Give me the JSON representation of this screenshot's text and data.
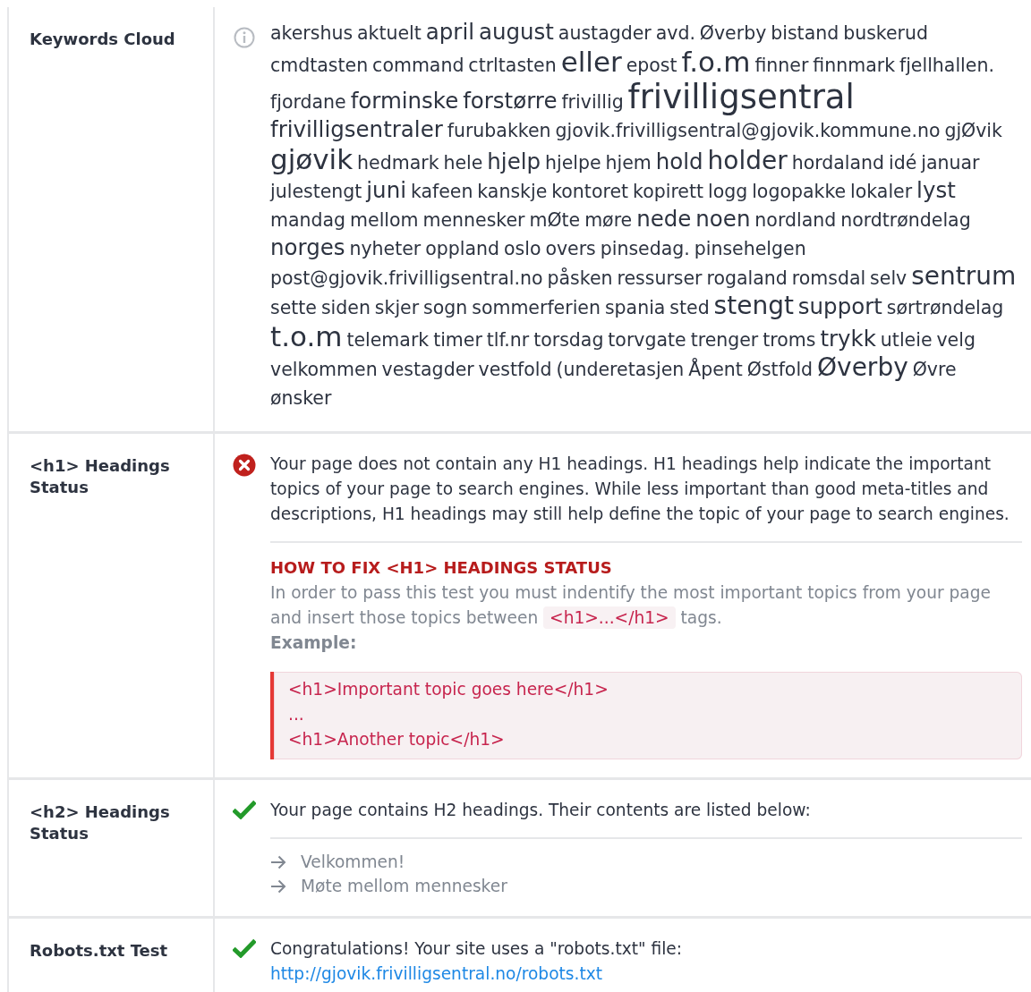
{
  "rows": [
    {
      "label": "Keywords Cloud",
      "kind": "info",
      "keywords": [
        {
          "word": "akershus",
          "kind": "low"
        },
        {
          "word": "aktuelt",
          "kind": "low"
        },
        {
          "word": "april",
          "kind": "medium"
        },
        {
          "word": "august",
          "kind": "medium"
        },
        {
          "word": "austagder",
          "kind": "low"
        },
        {
          "word": "avd.",
          "kind": "low"
        },
        {
          "word": "Øverby",
          "kind": "low"
        },
        {
          "word": "bistand",
          "kind": "low"
        },
        {
          "word": "buskerud",
          "kind": "low"
        },
        {
          "word": "cmdtasten",
          "kind": "low"
        },
        {
          "word": "command",
          "kind": "low"
        },
        {
          "word": "ctrltasten",
          "kind": "low"
        },
        {
          "word": "eller",
          "kind": "higher"
        },
        {
          "word": "epost",
          "kind": "low"
        },
        {
          "word": "f.o.m",
          "kind": "higher"
        },
        {
          "word": "finner",
          "kind": "low"
        },
        {
          "word": "finnmark",
          "kind": "low"
        },
        {
          "word": "fjellhallen.",
          "kind": "low"
        },
        {
          "word": "fjordane",
          "kind": "low"
        },
        {
          "word": "forminske",
          "kind": "medium"
        },
        {
          "word": "forstørre",
          "kind": "medium"
        },
        {
          "word": "frivillig",
          "kind": "low"
        },
        {
          "word": "frivilligsentral",
          "kind": "top"
        },
        {
          "word": "frivilligsentraler",
          "kind": "medium"
        },
        {
          "word": "furubakken",
          "kind": "low"
        },
        {
          "word": "gjovik.frivilligsentral@gjovik.kommune.no",
          "kind": "low"
        },
        {
          "word": "gjØvik",
          "kind": "low"
        },
        {
          "word": "gjøvik",
          "kind": "higher"
        },
        {
          "word": "hedmark",
          "kind": "low"
        },
        {
          "word": "hele",
          "kind": "low"
        },
        {
          "word": "hjelp",
          "kind": "medium"
        },
        {
          "word": "hjelpe",
          "kind": "low"
        },
        {
          "word": "hjem",
          "kind": "low"
        },
        {
          "word": "hold",
          "kind": "medium"
        },
        {
          "word": "holder",
          "kind": "high"
        },
        {
          "word": "hordaland",
          "kind": "low"
        },
        {
          "word": "idé",
          "kind": "low"
        },
        {
          "word": "januar",
          "kind": "low"
        },
        {
          "word": "julestengt",
          "kind": "low"
        },
        {
          "word": "juni",
          "kind": "medium"
        },
        {
          "word": "kafeen",
          "kind": "low"
        },
        {
          "word": "kanskje",
          "kind": "low"
        },
        {
          "word": "kontoret",
          "kind": "low"
        },
        {
          "word": "kopirett",
          "kind": "low"
        },
        {
          "word": "logg",
          "kind": "low"
        },
        {
          "word": "logopakke",
          "kind": "low"
        },
        {
          "word": "lokaler",
          "kind": "low"
        },
        {
          "word": "lyst",
          "kind": "medium"
        },
        {
          "word": "mandag",
          "kind": "low"
        },
        {
          "word": "mellom",
          "kind": "low"
        },
        {
          "word": "mennesker",
          "kind": "low"
        },
        {
          "word": "mØte",
          "kind": "low"
        },
        {
          "word": "møre",
          "kind": "low"
        },
        {
          "word": "nede",
          "kind": "medium"
        },
        {
          "word": "noen",
          "kind": "medium"
        },
        {
          "word": "nordland",
          "kind": "low"
        },
        {
          "word": "nordtrøndelag",
          "kind": "low"
        },
        {
          "word": "norges",
          "kind": "medium"
        },
        {
          "word": "nyheter",
          "kind": "low"
        },
        {
          "word": "oppland",
          "kind": "low"
        },
        {
          "word": "oslo",
          "kind": "low"
        },
        {
          "word": "overs",
          "kind": "low"
        },
        {
          "word": "pinsedag.",
          "kind": "low"
        },
        {
          "word": "pinsehelgen",
          "kind": "low"
        },
        {
          "word": "post@gjovik.frivilligsentral.no",
          "kind": "low"
        },
        {
          "word": "påsken",
          "kind": "low"
        },
        {
          "word": "ressurser",
          "kind": "low"
        },
        {
          "word": "rogaland",
          "kind": "low"
        },
        {
          "word": "romsdal",
          "kind": "low"
        },
        {
          "word": "selv",
          "kind": "low"
        },
        {
          "word": "sentrum",
          "kind": "high"
        },
        {
          "word": "sette",
          "kind": "low"
        },
        {
          "word": "siden",
          "kind": "low"
        },
        {
          "word": "skjer",
          "kind": "low"
        },
        {
          "word": "sogn",
          "kind": "low"
        },
        {
          "word": "sommerferien",
          "kind": "low"
        },
        {
          "word": "spania",
          "kind": "low"
        },
        {
          "word": "sted",
          "kind": "low"
        },
        {
          "word": "stengt",
          "kind": "high"
        },
        {
          "word": "support",
          "kind": "medium"
        },
        {
          "word": "sørtrøndelag",
          "kind": "low"
        },
        {
          "word": "t.o.m",
          "kind": "higher"
        },
        {
          "word": "telemark",
          "kind": "low"
        },
        {
          "word": "timer",
          "kind": "low"
        },
        {
          "word": "tlf.nr",
          "kind": "low"
        },
        {
          "word": "torsdag",
          "kind": "low"
        },
        {
          "word": "torvgate",
          "kind": "low"
        },
        {
          "word": "trenger",
          "kind": "low"
        },
        {
          "word": "troms",
          "kind": "low"
        },
        {
          "word": "trykk",
          "kind": "medium"
        },
        {
          "word": "utleie",
          "kind": "low"
        },
        {
          "word": "velg",
          "kind": "low"
        },
        {
          "word": "velkommen",
          "kind": "low"
        },
        {
          "word": "vestagder",
          "kind": "low"
        },
        {
          "word": "vestfold",
          "kind": "low"
        },
        {
          "word": "(underetasjen",
          "kind": "low"
        },
        {
          "word": "Åpent",
          "kind": "low"
        },
        {
          "word": "Østfold",
          "kind": "low"
        },
        {
          "word": "Øverby",
          "kind": "high"
        },
        {
          "word": "Øvre",
          "kind": "low"
        },
        {
          "word": "ønsker",
          "kind": "low"
        }
      ]
    },
    {
      "label": "<h1> Headings Status",
      "kind": "error",
      "message": "Your page does not contain any H1 headings. H1 headings help indicate the important topics of your page to search engines. While less important than good meta-titles and descriptions, H1 headings may still help define the topic of your page to search engines.",
      "fix": {
        "title": "HOW TO FIX <H1> HEADINGS STATUS",
        "text_before": "In order to pass this test you must indentify the most important topics from your page and insert those topics between",
        "code": "<h1>...</h1>",
        "text_after": "tags.",
        "example_label": "Example:",
        "example_lines": [
          "<h1>Important topic goes here</h1>",
          "...",
          "<h1>Another topic</h1>"
        ]
      }
    },
    {
      "label": "<h2> Headings Status",
      "kind": "pass",
      "message": "Your page contains H2 headings. Their contents are listed below:",
      "headings": [
        "Velkommen!",
        "Møte mellom mennesker"
      ]
    },
    {
      "label": "Robots.txt Test",
      "kind": "pass",
      "message": "Congratulations! Your site uses a \"robots.txt\" file:",
      "link": "http://gjovik.frivilligsentral.no/robots.txt"
    }
  ]
}
